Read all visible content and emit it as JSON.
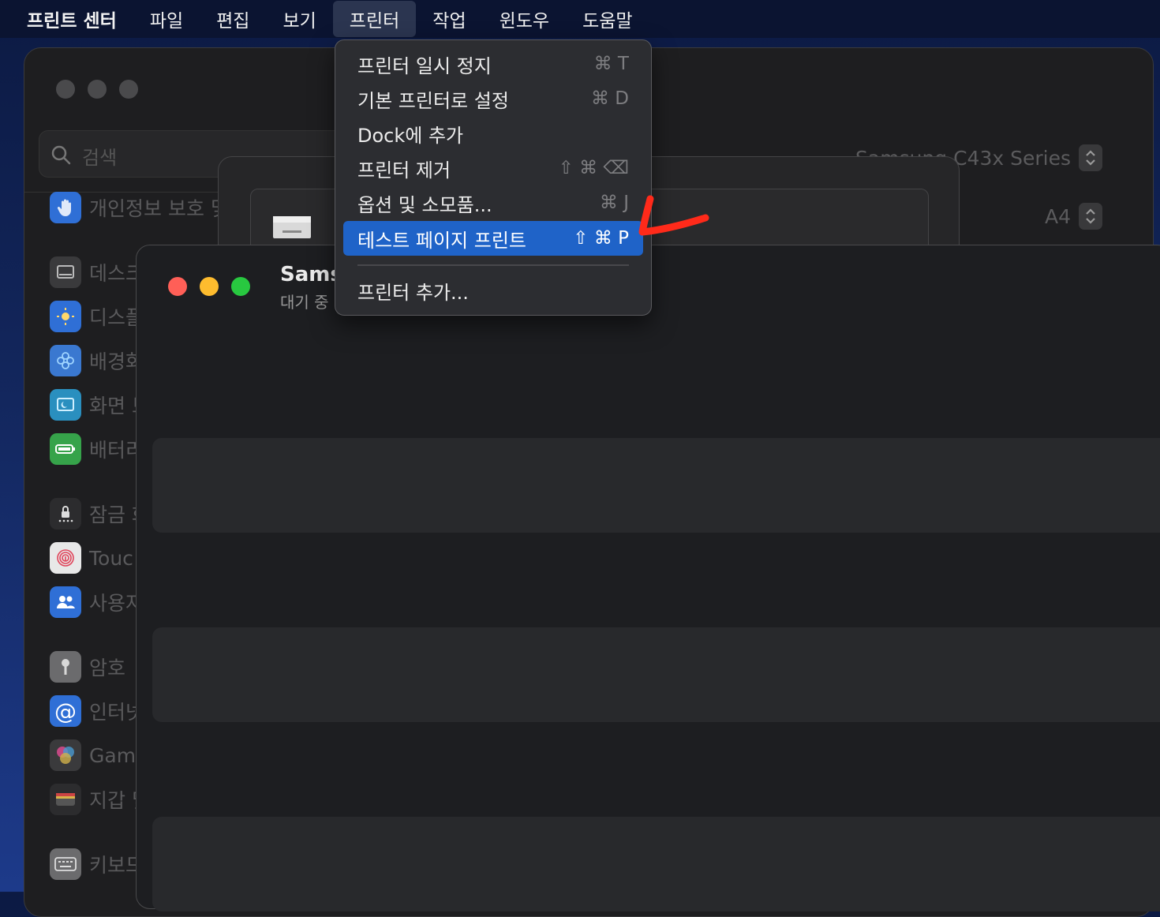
{
  "menubar": {
    "app_name": "프린트 센터",
    "items": [
      "파일",
      "편집",
      "보기",
      "프린터",
      "작업",
      "윈도우",
      "도움말"
    ],
    "active": "프린터"
  },
  "settings_window": {
    "search_placeholder": "검색",
    "sidebar": [
      {
        "label": "개인정보 보호 및",
        "icon": "hand-icon",
        "color": "#2f6fd6"
      },
      {
        "label": "데스크",
        "icon": "desktop-icon",
        "color": "#3a3a3c"
      },
      {
        "label": "디스플",
        "icon": "brightness-icon",
        "color": "#2f6fd6"
      },
      {
        "label": "배경화",
        "icon": "flower-icon",
        "color": "#3a78d0"
      },
      {
        "label": "화면 보",
        "icon": "screensaver-icon",
        "color": "#2a8fbf"
      },
      {
        "label": "배터리",
        "icon": "battery-icon",
        "color": "#36a34a"
      },
      {
        "label": "잠금 화",
        "icon": "lock-icon",
        "color": "#2c2c2e"
      },
      {
        "label": "Touc",
        "icon": "fingerprint-icon",
        "color": "#e8e8e8"
      },
      {
        "label": "사용자",
        "icon": "users-icon",
        "color": "#2f6fd6"
      },
      {
        "label": "암호",
        "icon": "key-icon",
        "color": "#6b6b6d"
      },
      {
        "label": "인터넷",
        "icon": "at-icon",
        "color": "#2f6fd6"
      },
      {
        "label": "Game",
        "icon": "game-center-icon",
        "color": "#d04a8a"
      },
      {
        "label": "지갑 및",
        "icon": "wallet-icon",
        "color": "#2c2c2e"
      },
      {
        "label": "키보드",
        "icon": "keyboard-icon",
        "color": "#6b6b6d"
      }
    ],
    "printer_select": "Samsung C43x Series",
    "paper_select": "A4"
  },
  "queue_window": {
    "title": "Sams",
    "status": "대기 중",
    "traffic_colors": [
      "#ff5f57",
      "#febc2e",
      "#28c840"
    ]
  },
  "dropdown": {
    "items": [
      {
        "label": "프린터 일시 정지",
        "shortcut": "⌘ T"
      },
      {
        "label": "기본 프린터로 설정",
        "shortcut": "⌘ D"
      },
      {
        "label": "Dock에 추가",
        "shortcut": ""
      },
      {
        "label": "프린터 제거",
        "shortcut": "⇧ ⌘ ⌫"
      },
      {
        "label": "옵션 및 소모품...",
        "shortcut": "⌘ J"
      },
      {
        "label": "테스트 페이지 프린트",
        "shortcut": "⇧ ⌘ P"
      }
    ],
    "highlighted": "테스트 페이지 프린트",
    "after_separator": {
      "label": "프린터 추가...",
      "shortcut": ""
    }
  },
  "annotation": {
    "color": "#ff2a1a",
    "icon": "checkmark-annotation"
  }
}
